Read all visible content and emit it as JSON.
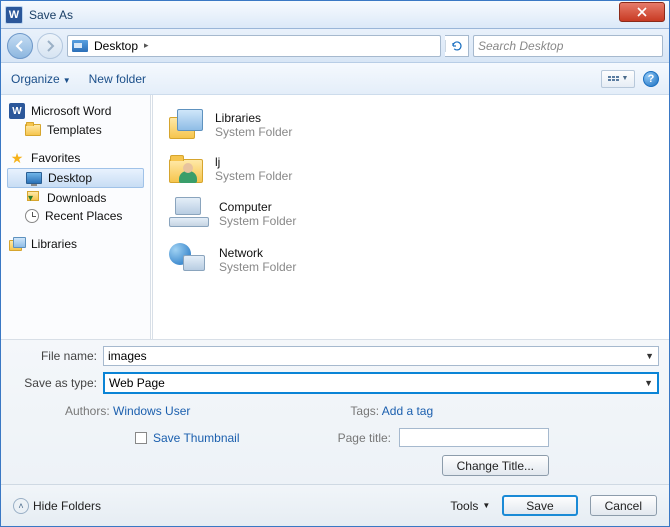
{
  "window": {
    "title": "Save As"
  },
  "nav": {
    "location": "Desktop",
    "search_placeholder": "Search Desktop"
  },
  "toolbar": {
    "organize": "Organize",
    "new_folder": "New folder"
  },
  "tree": {
    "root1": "Microsoft Word",
    "root1_items": [
      "Templates"
    ],
    "root2": "Favorites",
    "root2_items": [
      "Desktop",
      "Downloads",
      "Recent Places"
    ],
    "root3": "Libraries"
  },
  "items": [
    {
      "name": "Libraries",
      "sub": "System Folder",
      "icon": "libbig"
    },
    {
      "name": "lj",
      "sub": "System Folder",
      "icon": "userfld"
    },
    {
      "name": "Computer",
      "sub": "System Folder",
      "icon": "comp"
    },
    {
      "name": "Network",
      "sub": "System Folder",
      "icon": "net"
    }
  ],
  "form": {
    "filename_label": "File name:",
    "filename_value": "images",
    "type_label": "Save as type:",
    "type_value": "Web Page",
    "authors_label": "Authors:",
    "authors_value": "Windows User",
    "tags_label": "Tags:",
    "tags_value": "Add a tag",
    "thumb_label": "Save Thumbnail",
    "page_title_label": "Page title:",
    "change_title": "Change Title..."
  },
  "footer": {
    "hide": "Hide Folders",
    "tools": "Tools",
    "save": "Save",
    "cancel": "Cancel"
  }
}
